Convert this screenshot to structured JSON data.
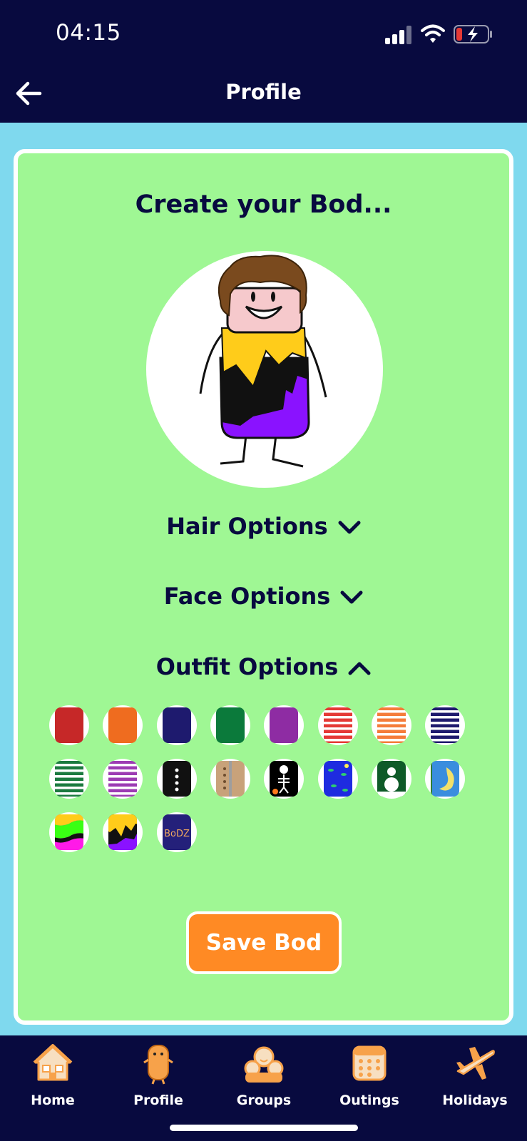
{
  "status": {
    "time": "04:15",
    "battery_color": "#e53935"
  },
  "header": {
    "title": "Profile",
    "back_icon": "arrow-left-icon"
  },
  "card": {
    "title": "Create your Bod...",
    "options": [
      {
        "label": "Hair Options",
        "expanded": false,
        "icon": "chevron-down-icon"
      },
      {
        "label": "Face Options",
        "expanded": false,
        "icon": "chevron-down-icon"
      },
      {
        "label": "Outfit Options",
        "expanded": true,
        "icon": "chevron-up-icon"
      }
    ],
    "outfits": [
      {
        "name": "red",
        "colors": [
          "#c62828"
        ]
      },
      {
        "name": "orange",
        "colors": [
          "#ef6c1f"
        ]
      },
      {
        "name": "navy",
        "colors": [
          "#1e1a6e"
        ]
      },
      {
        "name": "green",
        "colors": [
          "#0b7a3b"
        ]
      },
      {
        "name": "purple",
        "colors": [
          "#8e2ca3"
        ]
      },
      {
        "name": "red-stripes",
        "colors": [
          "#e53935",
          "#ffffff"
        ]
      },
      {
        "name": "orange-stripes",
        "colors": [
          "#f57c3a",
          "#ffffff"
        ]
      },
      {
        "name": "navy-stripes",
        "colors": [
          "#1e1a6e",
          "#ffffff"
        ]
      },
      {
        "name": "green-stripes",
        "colors": [
          "#1b7a3f",
          "#ffffff"
        ]
      },
      {
        "name": "purple-stripes",
        "colors": [
          "#9c3bb3",
          "#ffffff"
        ]
      },
      {
        "name": "black-suit",
        "colors": [
          "#111111",
          "#ffffff"
        ]
      },
      {
        "name": "tan-coat",
        "colors": [
          "#c8a27a",
          "#6d4c2e"
        ]
      },
      {
        "name": "skeleton",
        "colors": [
          "#000000",
          "#ffffff"
        ]
      },
      {
        "name": "blue-night",
        "colors": [
          "#1e2be0",
          "#2ecc71"
        ]
      },
      {
        "name": "snowman",
        "colors": [
          "#0e5a28",
          "#ffffff"
        ]
      },
      {
        "name": "moon",
        "colors": [
          "#3a8dde",
          "#f2e06b"
        ]
      },
      {
        "name": "neon-waves",
        "colors": [
          "#ff1ae8",
          "#39ff14"
        ]
      },
      {
        "name": "yellow-black-purple",
        "colors": [
          "#ffcc1a",
          "#8a12ff"
        ]
      },
      {
        "name": "bodz",
        "colors": [
          "#24207a",
          "#f0a860"
        ],
        "text": "BoDZ"
      }
    ],
    "save_label": "Save Bod"
  },
  "nav": [
    {
      "label": "Home",
      "icon": "home-icon"
    },
    {
      "label": "Profile",
      "icon": "profile-bod-icon"
    },
    {
      "label": "Groups",
      "icon": "groups-icon"
    },
    {
      "label": "Outings",
      "icon": "calendar-icon"
    },
    {
      "label": "Holidays",
      "icon": "airplane-icon"
    }
  ],
  "colors": {
    "header_bg": "#080a3f",
    "page_bg": "#7fd9ee",
    "card_bg": "#9ff794",
    "accent": "#ff8a24",
    "nav_icon": "#f7a24a"
  }
}
